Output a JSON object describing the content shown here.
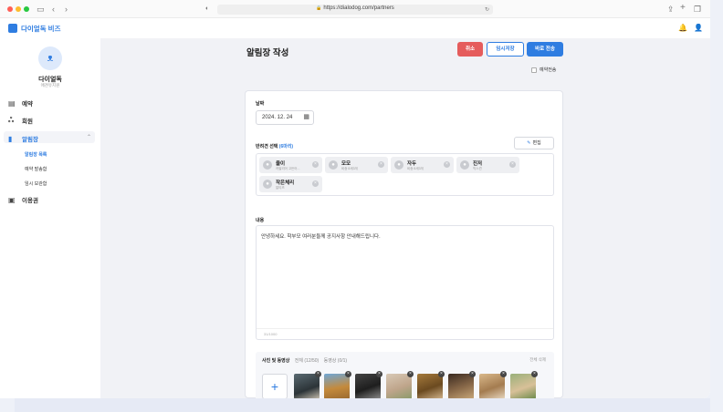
{
  "browser": {
    "url": "https://dialodog.com/partners",
    "traffic_colors": [
      "#ff5f57",
      "#febc2e",
      "#28c840"
    ]
  },
  "app": {
    "logo_text": "다이얼독 비즈",
    "brand_color": "#2f7de1"
  },
  "sidebar": {
    "school_name": "다이얼독",
    "school_sub": "애견유치원",
    "menu": [
      {
        "label": "예약",
        "icon": "calendar-icon"
      },
      {
        "label": "회원",
        "icon": "users-icon"
      },
      {
        "label": "알림장",
        "icon": "notebook-icon",
        "active": true
      },
      {
        "label": "이용권",
        "icon": "ticket-icon"
      }
    ],
    "submenu": [
      {
        "label": "알림장 목록",
        "active": true
      },
      {
        "label": "예약 발송함"
      },
      {
        "label": "임시 보관함"
      }
    ]
  },
  "page": {
    "title": "알림장 작성",
    "cancel_label": "취소",
    "temp_save_label": "임시저장",
    "send_label": "바로 전송",
    "schedule_label": "예약전송"
  },
  "form": {
    "date_label": "날짜",
    "date_value": "2024. 12. 24",
    "kids_label": "반려견 선택",
    "kids_count": "(6마리)",
    "edit_label": "편집",
    "kids": [
      {
        "name": "율이",
        "sub": "카발리어 고든어..."
      },
      {
        "name": "모모",
        "sub": "비숑 8세3개"
      },
      {
        "name": "자두",
        "sub": "비숑 8세3개"
      },
      {
        "name": "진저",
        "sub": "믹스견"
      },
      {
        "name": "작은체리",
        "sub": "말티즈"
      }
    ],
    "content_label": "내용",
    "content_text": "안녕하세요. 학부모 여러분들께 공지사항 안내해드립니다.",
    "content_count": "31/1000",
    "photos_label": "사진 및 동영상",
    "photos_all": "전체 (12/50)",
    "photos_video": "동영상 (0/1)",
    "photos_delete_all": "전체 삭제",
    "add_icon": "plus-icon"
  }
}
